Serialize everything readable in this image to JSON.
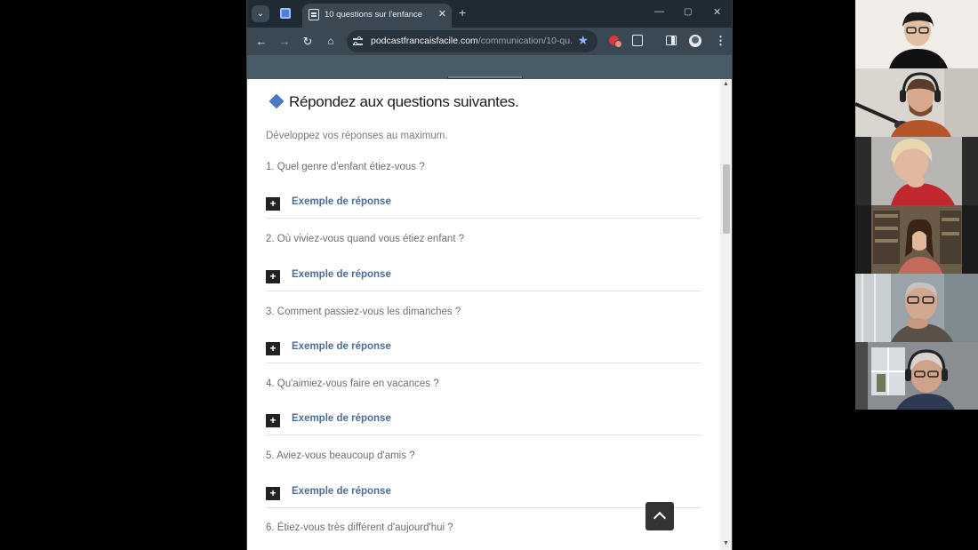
{
  "browser": {
    "tab_title": "10 questions sur l'enfance",
    "url_domain": "podcastfrancaisfacile.com",
    "url_path": "/communication/10-qu..."
  },
  "page": {
    "heading": "Répondez aux questions suivantes.",
    "intro": "Développez vos réponses au maximum.",
    "answer_toggle_label": "Exemple de réponse",
    "questions": [
      "1. Quel genre d'enfant étiez-vous ?",
      "2. Où viviez-vous quand vous étiez enfant ?",
      "3. Comment passiez-vous les dimanches ?",
      "4. Qu'aimiez-vous faire en vacances ?",
      "5. Aviez-vous beaucoup d'amis ?",
      "6. Étiez-vous très différent d'aujourd'hui ?"
    ]
  },
  "colors": {
    "accent_diamond": "#4a7bc0",
    "link": "#4b6e96",
    "browser_chrome": "#3a4853"
  },
  "icons": [
    "tab-search-icon",
    "back-icon",
    "forward-icon",
    "reload-icon",
    "home-icon",
    "tune-icon",
    "star-icon",
    "extension-icon",
    "puzzle-icon",
    "side-panel-icon",
    "profile-icon",
    "menu-icon",
    "plus-icon",
    "arrow-up-icon"
  ]
}
